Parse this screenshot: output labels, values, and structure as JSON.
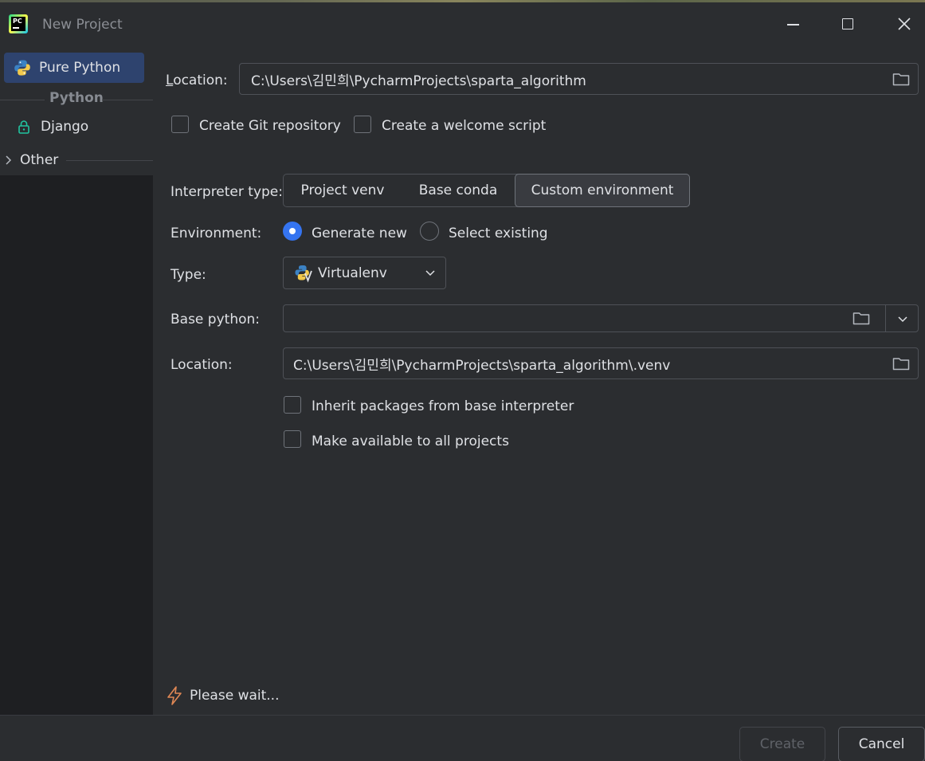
{
  "window": {
    "title": "New Project",
    "logo_text": "PC"
  },
  "sidebar": {
    "items": [
      {
        "label": "Pure Python",
        "icon": "python-icon",
        "selected": true
      },
      {
        "label": "Django",
        "icon": "lock-icon",
        "selected": false
      }
    ],
    "group_label": "Python",
    "other_label": "Other"
  },
  "form": {
    "location_label": "Location:",
    "location_value": "C:\\Users\\김민희\\PycharmProjects\\sparta_algorithm",
    "create_git_label": "Create Git repository",
    "create_git_checked": false,
    "welcome_script_label": "Create a welcome script",
    "welcome_script_checked": false,
    "interpreter_type_label": "Interpreter type:",
    "interpreter_types": [
      {
        "label": "Project venv",
        "selected": false
      },
      {
        "label": "Base conda",
        "selected": false
      },
      {
        "label": "Custom environment",
        "selected": true
      }
    ],
    "environment_label": "Environment:",
    "env_generate_new": "Generate new",
    "env_select_existing": "Select existing",
    "env_selected": "Generate new",
    "type_label": "Type:",
    "type_value": "Virtualenv",
    "base_python_label": "Base python:",
    "base_python_value": "",
    "venv_location_label": "Location:",
    "venv_location_value": "C:\\Users\\김민희\\PycharmProjects\\sparta_algorithm\\.venv",
    "inherit_label": "Inherit packages from base interpreter",
    "inherit_checked": false,
    "make_available_label": "Make available to all projects",
    "make_available_checked": false
  },
  "status": {
    "text": "Please wait...",
    "icon": "lightning-icon"
  },
  "footer": {
    "create_label": "Create",
    "cancel_label": "Cancel"
  },
  "colors": {
    "background": "#2b2d30",
    "sidebar_bg": "#1e1f22",
    "selection": "#2e436e",
    "accent": "#3574f0",
    "status_icon": "#e08855"
  }
}
